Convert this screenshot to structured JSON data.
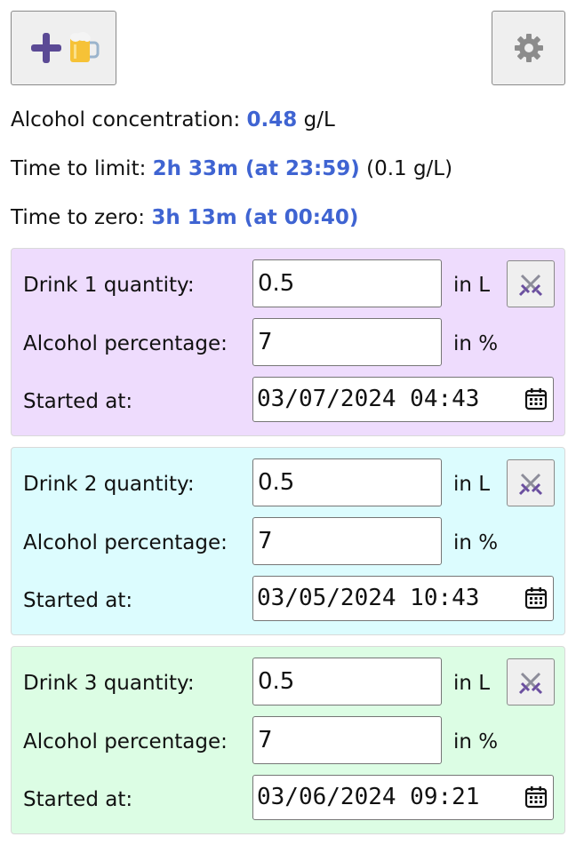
{
  "toolbar": {
    "add_icon": "plus-beer-icon",
    "settings_icon": "gear-icon"
  },
  "stats": {
    "concentration": {
      "label": "Alcohol concentration:",
      "value": "0.48",
      "unit": "g/L"
    },
    "time_to_limit": {
      "label": "Time to limit:",
      "value": "2h 33m (at 23:59)",
      "extra": "(0.1 g/L)"
    },
    "time_to_zero": {
      "label": "Time to zero:",
      "value": "3h 13m (at 00:40)"
    }
  },
  "colors": {
    "accent": "#3f64d2",
    "drink1_bg": "#eedcfd",
    "drink2_bg": "#dcfcfe",
    "drink3_bg": "#dcfde4"
  },
  "drinks": [
    {
      "quantity_label": "Drink 1 quantity:",
      "quantity": "0.5",
      "quantity_unit": "in L",
      "percentage_label": "Alcohol percentage:",
      "percentage": "7",
      "percentage_unit": "in %",
      "started_label": "Started at:",
      "started": "03/07/2024 04:43",
      "delete_icon": "crossed-swords-icon"
    },
    {
      "quantity_label": "Drink 2 quantity:",
      "quantity": "0.5",
      "quantity_unit": "in L",
      "percentage_label": "Alcohol percentage:",
      "percentage": "7",
      "percentage_unit": "in %",
      "started_label": "Started at:",
      "started": "03/05/2024 10:43",
      "delete_icon": "crossed-swords-icon"
    },
    {
      "quantity_label": "Drink 3 quantity:",
      "quantity": "0.5",
      "quantity_unit": "in L",
      "percentage_label": "Alcohol percentage:",
      "percentage": "7",
      "percentage_unit": "in %",
      "started_label": "Started at:",
      "started": "03/06/2024 09:21",
      "delete_icon": "crossed-swords-icon"
    }
  ]
}
